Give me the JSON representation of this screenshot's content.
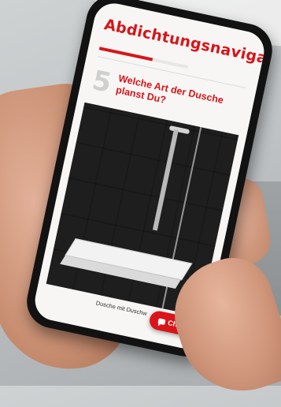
{
  "app": {
    "title": "Abdichtungsnavigator",
    "accent_color": "#d9141a"
  },
  "progress": {
    "fraction": 0.6
  },
  "question": {
    "step": "5",
    "text": "Welche Art der Dusche planst Du?"
  },
  "option": {
    "caption": "Dusche mit Duschw"
  },
  "chat": {
    "label": "Chat",
    "icon": "chat-bubble-icon"
  }
}
